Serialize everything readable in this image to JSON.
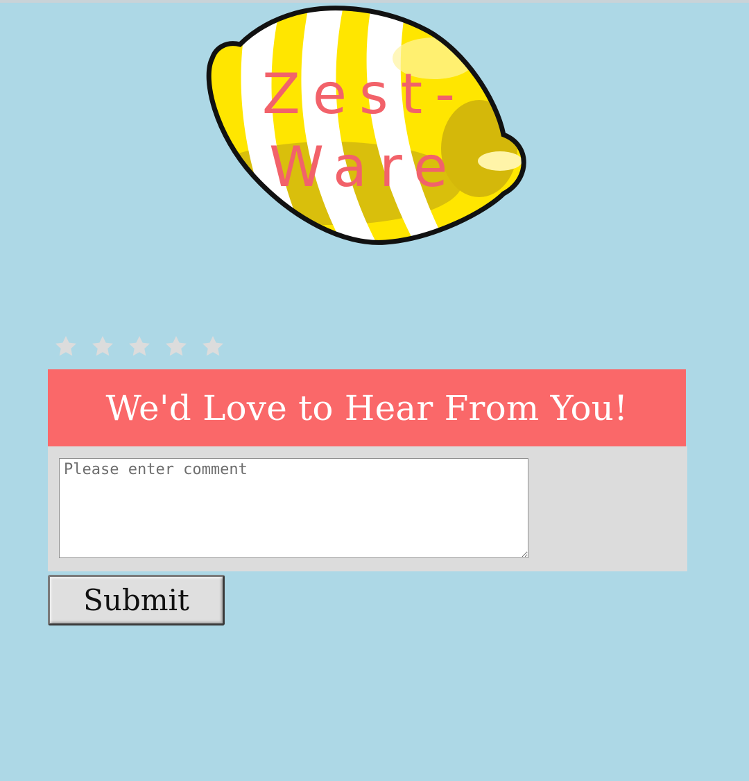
{
  "logo": {
    "line1": "Zest-",
    "line2": "Ware"
  },
  "rating": {
    "max": 5,
    "value": 0,
    "star_icon": "star-icon"
  },
  "feedback": {
    "title": "We'd Love to Hear From You!",
    "comment_placeholder": "Please enter comment",
    "comment_value": "",
    "submit_label": "Submit"
  },
  "colors": {
    "page_bg": "#add8e6",
    "header_bg": "#fa6869",
    "panel_bg": "#dcdcdc",
    "logo_text": "#f2626a",
    "star_inactive": "#dcdcdc"
  }
}
